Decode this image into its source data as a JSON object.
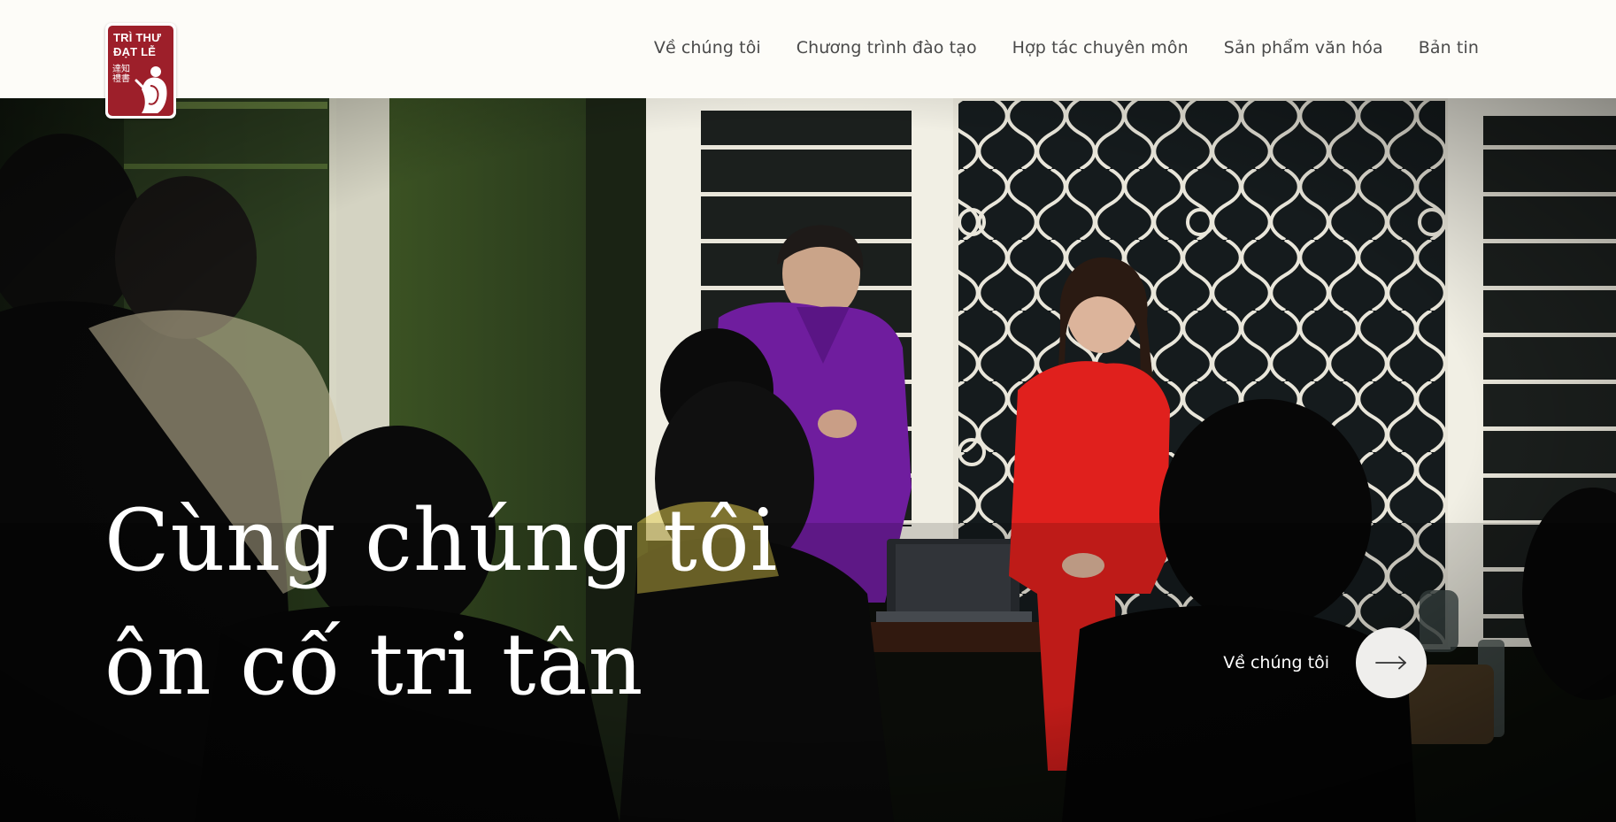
{
  "brand": {
    "logo_line1": "TRÌ THƯ",
    "logo_line2": "ĐẠT LỄ",
    "logo_cjk": "達知禮書",
    "logo_color": "#9d1f2a"
  },
  "nav": {
    "items": [
      {
        "label": "Về chúng tôi"
      },
      {
        "label": "Chương trình đào tạo"
      },
      {
        "label": "Hợp tác chuyên môn"
      },
      {
        "label": "Sản phẩm văn hóa"
      },
      {
        "label": "Bản tin"
      }
    ]
  },
  "hero": {
    "title_line1": "Cùng chúng tôi",
    "title_line2": "ôn cố tri tân",
    "cta_label": "Về chúng tôi",
    "cta_icon": "arrow-right-icon"
  },
  "colors": {
    "header_bg": "#fdfcf8",
    "nav_text": "#4a4a4a",
    "hero_text": "#ffffff",
    "cta_circle": "#efeeec"
  }
}
